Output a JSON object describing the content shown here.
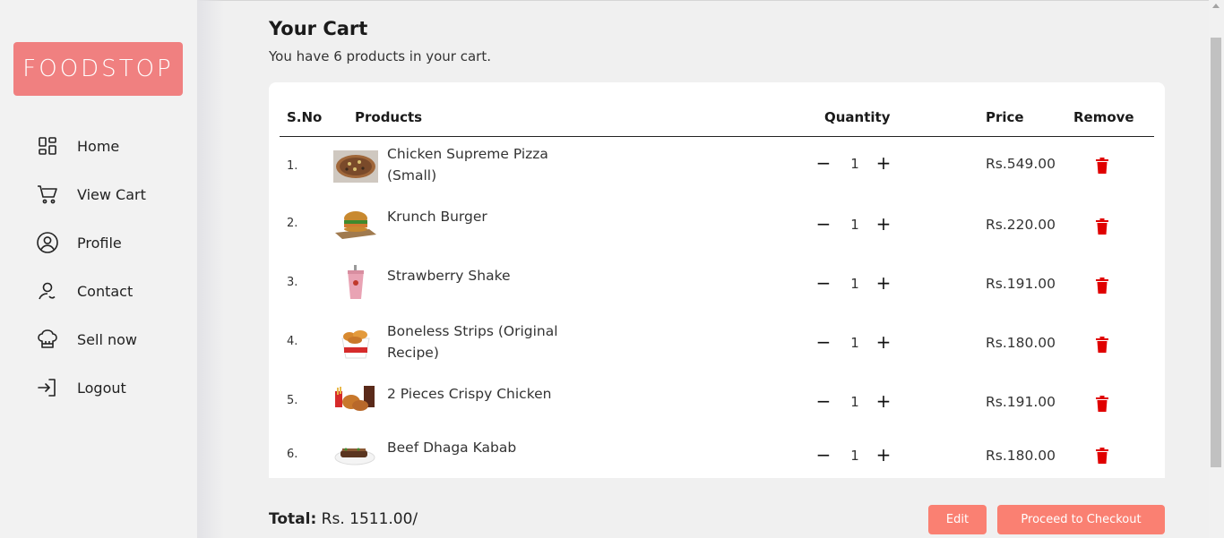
{
  "brand": {
    "logo_text": "FOODSTOP",
    "accent": "#f08080"
  },
  "sidebar": {
    "items": [
      {
        "label": "Home",
        "icon": "grid-icon"
      },
      {
        "label": "View Cart",
        "icon": "cart-icon"
      },
      {
        "label": "Profile",
        "icon": "user-circle-icon"
      },
      {
        "label": "Contact",
        "icon": "contact-icon"
      },
      {
        "label": "Sell now",
        "icon": "chef-hat-icon"
      },
      {
        "label": "Logout",
        "icon": "logout-icon"
      }
    ]
  },
  "cart": {
    "title": "Your Cart",
    "subtitle": "You have 6 products in your cart.",
    "columns": {
      "sno": "S.No",
      "products": "Products",
      "quantity": "Quantity",
      "price": "Price",
      "remove": "Remove"
    },
    "items": [
      {
        "sno": "1.",
        "name": "Chicken Supreme Pizza (Small)",
        "qty": "1",
        "price": "Rs.549.00",
        "image": "pizza"
      },
      {
        "sno": "2.",
        "name": "Krunch Burger",
        "qty": "1",
        "price": "Rs.220.00",
        "image": "burger"
      },
      {
        "sno": "3.",
        "name": "Strawberry Shake",
        "qty": "1",
        "price": "Rs.191.00",
        "image": "shake"
      },
      {
        "sno": "4.",
        "name": "Boneless Strips (Original Recipe)",
        "qty": "1",
        "price": "Rs.180.00",
        "image": "strips"
      },
      {
        "sno": "5.",
        "name": "2 Pieces Crispy Chicken",
        "qty": "1",
        "price": "Rs.191.00",
        "image": "chicken"
      },
      {
        "sno": "6.",
        "name": "Beef Dhaga Kabab",
        "qty": "1",
        "price": "Rs.180.00",
        "image": "kabab"
      }
    ],
    "qty_minus": "−",
    "qty_plus": "+",
    "total_label": "Total:",
    "total_value": "Rs. 1511.00/",
    "edit_label": "Edit",
    "checkout_label": "Proceed to Checkout"
  },
  "colors": {
    "button": "#fa8072",
    "trash": "#e00000"
  }
}
